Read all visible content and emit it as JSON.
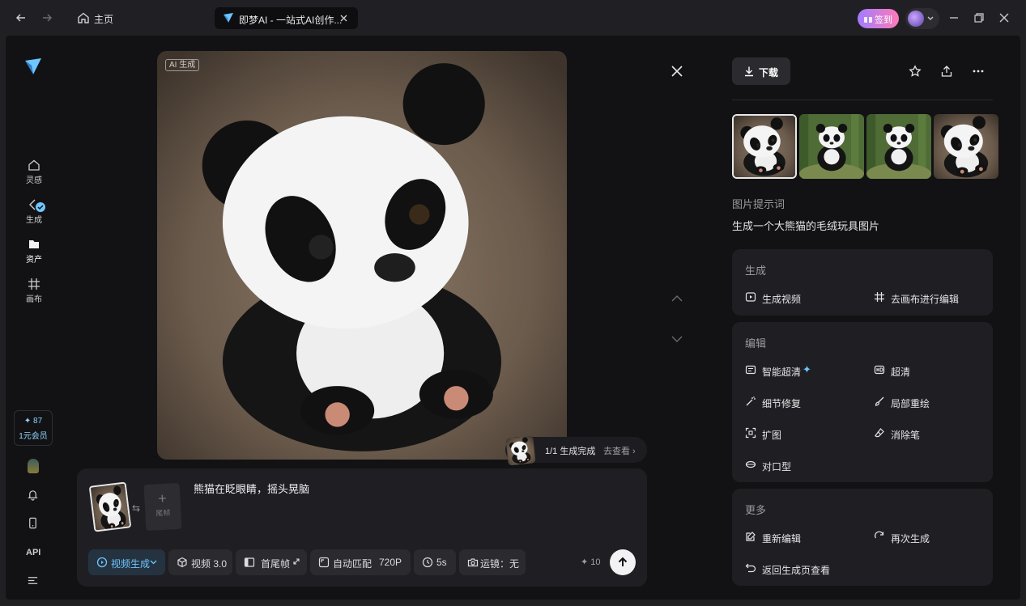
{
  "titlebar": {
    "home_label": "主页",
    "tab_title": "即梦AI - 一站式AI创作...",
    "signin_label": "签到"
  },
  "nav": {
    "items": [
      {
        "label": "灵感",
        "icon": "home-icon"
      },
      {
        "label": "生成",
        "icon": "generate-icon"
      },
      {
        "label": "资产",
        "icon": "folder-icon"
      },
      {
        "label": "画布",
        "icon": "canvas-icon"
      }
    ],
    "credits_value": "✦ 87",
    "credits_label": "1元会员",
    "api_label": "API"
  },
  "viewer": {
    "ai_badge": "AI 生成",
    "status_text": "1/1 生成完成",
    "status_link": "去查看 ›"
  },
  "prompt": {
    "text": "熊猫在眨眼睛，摇头晃脑",
    "end_frame_label": "尾帧",
    "swap_icon": "⇆",
    "chips": {
      "mode": "视频生成",
      "model": "视频 3.0",
      "frames": "首尾帧",
      "ratio": "自动匹配",
      "resolution": "720P",
      "duration": "5s",
      "camera": "运镜：无"
    },
    "cost": "✦ 10"
  },
  "right": {
    "download_label": "下载",
    "prompt_label": "图片提示词",
    "prompt_value": "生成一个大熊猫的毛绒玩具图片",
    "sections": {
      "generate": {
        "title": "生成",
        "actions": [
          "生成视频",
          "去画布进行编辑"
        ]
      },
      "edit": {
        "title": "编辑",
        "actions": [
          "智能超清",
          "超清",
          "细节修复",
          "局部重绘",
          "扩图",
          "消除笔",
          "对口型"
        ]
      },
      "more": {
        "title": "更多",
        "actions": [
          "重新编辑",
          "再次生成",
          "返回生成页查看"
        ]
      }
    }
  },
  "colors": {
    "accent": "#6ec6ff",
    "background": "#121214",
    "panel": "#1f1f23"
  }
}
